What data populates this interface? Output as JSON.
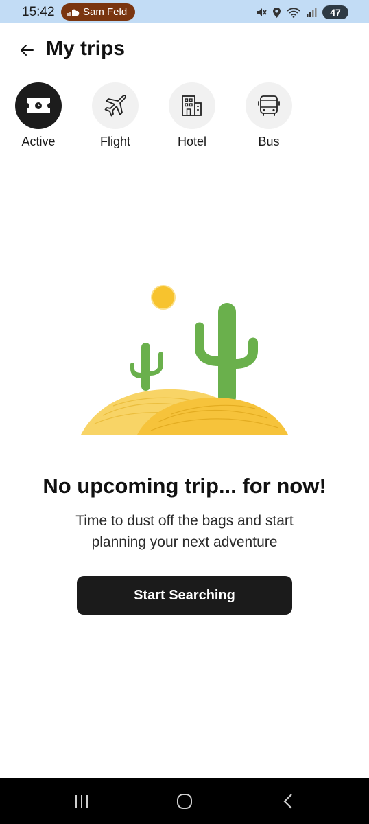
{
  "status_bar": {
    "time": "15:42",
    "media_label": "Sam Feld",
    "battery": "47",
    "icons": [
      "soundcloud-icon",
      "mute-icon",
      "location-icon",
      "wifi-icon",
      "signal-icon",
      "battery-icon"
    ]
  },
  "header": {
    "back_icon": "arrow-left-icon",
    "title": "My trips"
  },
  "tabs": [
    {
      "label": "Active",
      "icon": "ticket-icon",
      "selected": true
    },
    {
      "label": "Flight",
      "icon": "airplane-icon",
      "selected": false
    },
    {
      "label": "Hotel",
      "icon": "building-icon",
      "selected": false
    },
    {
      "label": "Bus",
      "icon": "bus-icon",
      "selected": false
    }
  ],
  "empty_state": {
    "illustration": "desert-cactus-illustration",
    "title": "No upcoming trip... for now!",
    "description": "Time to dust off the bags and start planning your next adventure",
    "button_label": "Start Searching"
  },
  "nav_bar": {
    "icons": [
      "recent-apps-icon",
      "home-icon",
      "back-icon"
    ]
  },
  "colors": {
    "status_bar_bg": "#c2dcf5",
    "media_pill": "#7a3510",
    "active_tab": "#1c1c1c",
    "button_bg": "#1b1b1b",
    "cactus_green": "#6ab04c",
    "sand_yellow": "#f6c93b",
    "sun_yellow": "#f7c32e"
  }
}
